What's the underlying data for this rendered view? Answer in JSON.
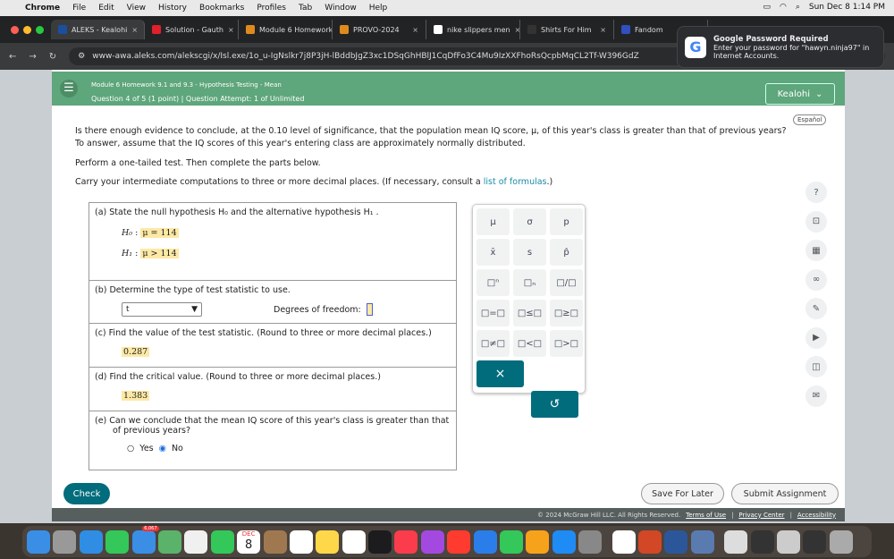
{
  "menubar": {
    "items": [
      "Chrome",
      "File",
      "Edit",
      "View",
      "History",
      "Bookmarks",
      "Profiles",
      "Tab",
      "Window",
      "Help"
    ],
    "datetime": "Sun Dec 8  1:14 PM"
  },
  "tabs": [
    {
      "label": "ALEKS - Kealohi",
      "color": "#1a4fa0"
    },
    {
      "label": "Solution - Gauth",
      "color": "#e0202a"
    },
    {
      "label": "Module 6 Homework",
      "color": "#e08a1e"
    },
    {
      "label": "PROVO-2024",
      "color": "#e08a1e"
    },
    {
      "label": "nike slippers men",
      "color": "#ffffff"
    },
    {
      "label": "Shirts For Him",
      "color": "#333333"
    },
    {
      "label": "Fandom",
      "color": "#3050c0"
    }
  ],
  "url": "www-awa.aleks.com/alekscgi/x/Isl.exe/1o_u-IgNslkr7j8P3jH-lBddbJgZ3xc1DSqGhHBlJ1CqDfFo3C4Mu9IzXXFhoRsQcpbMqCL2Tf-W396GdZ",
  "password_popup": {
    "title": "Google Password Required",
    "body": "Enter your password for \"hawyn.ninja97\" in Internet Accounts."
  },
  "header": {
    "module": "Module 6 Homework 9.1 and 9.3 - Hypothesis Testing - Mean",
    "question": "Question 4 of 5 (1 point)  |  Question Attempt: 1 of Unlimited",
    "user": "Kealohi"
  },
  "espanol": "Español",
  "question": {
    "p1": "Is there enough evidence to conclude, at the 0.10 level of significance, that the population mean IQ score, μ, of this year's class is greater than that of previous years? To answer, assume that the IQ scores of this year's entering class are approximately normally distributed.",
    "p2": "Perform a one-tailed test. Then complete the parts below.",
    "p3": "Carry your intermediate computations to three or more decimal places. (If necessary, consult a ",
    "link": "list of formulas",
    "p3end": ".)"
  },
  "parts": {
    "a": {
      "prompt": "(a)  State the null hypothesis H₀ and the alternative hypothesis H₁ .",
      "h0_label": "H₀",
      "h0": "μ = 114",
      "h1_label": "H₁",
      "h1": "μ > 114"
    },
    "b": {
      "prompt": "(b)  Determine the type of test statistic to use.",
      "selected": "t",
      "df_label": "Degrees of freedom:",
      "df_value": ""
    },
    "c": {
      "prompt": "(c)  Find the value of the test statistic. (Round to three or more decimal places.)",
      "value": "0.287"
    },
    "d": {
      "prompt": "(d)  Find the critical value. (Round to three or more decimal places.)",
      "value": "1.383"
    },
    "e": {
      "prompt": "(e)  Can we conclude that the mean IQ score of this year's class is greater than that of previous years?",
      "yes": "Yes",
      "no": "No",
      "selected": "No"
    }
  },
  "keypad": [
    "μ",
    "σ",
    "p",
    "x̄",
    "s",
    "p̂",
    "□ⁿ",
    "□ₙ",
    "□/□",
    "□=□",
    "□≤□",
    "□≥□",
    "□≠□",
    "□<□",
    "□>□"
  ],
  "keypad_actions": {
    "clear": "×",
    "undo": "↺"
  },
  "sidebar_icons": [
    "help-icon",
    "whiteboard-icon",
    "calculator-icon",
    "glasses-icon",
    "notes-icon",
    "video-icon",
    "ebook-icon",
    "mail-icon"
  ],
  "buttons": {
    "check": "Check",
    "save": "Save For Later",
    "submit": "Submit Assignment"
  },
  "footer": {
    "copyright": "© 2024 McGraw Hill LLC. All Rights Reserved.",
    "terms": "Terms of Use",
    "privacy": "Privacy Center",
    "accessibility": "Accessibility"
  },
  "dock": {
    "mail_badge": "6,067",
    "calendar_month": "DEC",
    "calendar_day": "8",
    "colors": [
      "#3a8ee6",
      "#999999",
      "#2f8de4",
      "#34c759",
      "#3a8ee6",
      "#5bb26a",
      "#f0f0f0",
      "#34c759",
      "#ffffff",
      "#a07850",
      "#ffffff",
      "#ffd84a",
      "#ffffff",
      "#1c1c1e",
      "#fa3c4c",
      "#a349e0",
      "#ff3b30",
      "#2b7de9",
      "#34c759",
      "#f7a21b",
      "#1f8bf5",
      "#888888",
      "#ffffff",
      "#d24726",
      "#2b579a",
      "#5a7bb0",
      "#dddddd",
      "#333333",
      "#cccccc",
      "#333333",
      "#aaaaaa"
    ]
  }
}
